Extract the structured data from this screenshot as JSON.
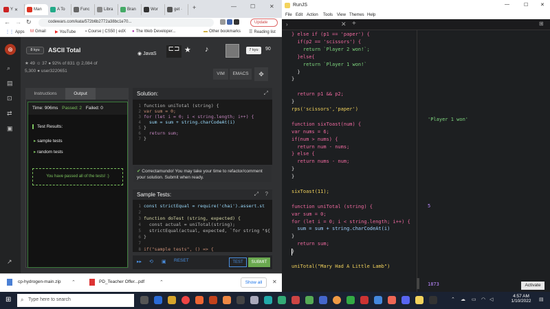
{
  "browser": {
    "tabs": [
      "Y",
      "Man",
      "A To",
      "Func",
      "Libra",
      "Bran",
      "Wor",
      "get ·"
    ],
    "url": "codewars.com/kata/572b6b2772a38bc1e70...",
    "update_label": "Update",
    "bookmarks": [
      "Apps",
      "Gmail",
      "YouTube",
      "Course | CS50 | edX",
      "The Web Developer...",
      "Other bookmarks",
      "Reading list"
    ]
  },
  "kata": {
    "rank": "8 kyu",
    "title": "ASCII Total",
    "stars": "49",
    "votes": "37",
    "satisfaction": "92% of 831",
    "completed": "2,084 of",
    "completed2": "5,300",
    "author": "user3220651",
    "language": "JavaS",
    "user_rank": "7 kyu",
    "honor": "90",
    "vim_label": "VIM",
    "emacs_label": "EMACS",
    "instructions_tab": "Instructions",
    "output_tab": "Output",
    "time": "Time: 906ms",
    "passed": "Passed: 2",
    "failed": "Failed: 0",
    "test_results": "Test Results:",
    "sample_tests_label": "sample tests",
    "random_tests_label": "random tests",
    "passed_msg": "You have passed all of the tests! :)",
    "solution_title": "Solution:",
    "toast": "Correctamundo! You may take your time to refactor/comment your solution. Submit when ready.",
    "sample_title": "Sample Tests:",
    "reset_label": "RESET",
    "test_label": "TEST",
    "submit_label": "SUBMIT",
    "solution_lines": [
      "function uniTotal (string) {",
      "var sum = 0;",
      "for (let i = 0; i < string.length; i++) {",
      "  sum = sum + string.charCodeAt(i)",
      "}",
      "  return sum;",
      "}"
    ],
    "sample_lines": [
      "const strictEqual = require('chai').assert.st",
      "",
      "function doTest (string, expected) {",
      "  const actual = uniTotal(string);",
      "  strictEqual(actual, expected, `for string \"${",
      "}",
      "",
      "if(\"sample tests\", () => {"
    ]
  },
  "downloads": {
    "file1": "cp-hydrogen-main.zip",
    "file2": "PD_Teacher Offer...pdf",
    "show_all": "Show all"
  },
  "runjs": {
    "title": "RunJS",
    "menu": [
      "File",
      "Edit",
      "Action",
      "Tools",
      "View",
      "Themes",
      "Help"
    ],
    "code_lines": [
      "} else if (p1 == 'paper') {",
      "  if(p2 == 'scissors') {",
      "    return `Player 2 won!`;",
      "  }else{",
      "    return `Player 1 won!`",
      "  }",
      "}",
      "",
      "  return p1 && p2;",
      "}",
      "rps('scissors','paper')",
      "",
      "function sixToast(num) {",
      "var nums = 6;",
      "if(num > nums) {",
      "  return num - nums;",
      "} else {",
      "  return nums - num;",
      "}",
      "}",
      "",
      "sixToast(11);",
      "",
      "function uniTotal (string) {",
      "var sum = 0;",
      "for (let i = 0; i < string.length; i++) {",
      "  sum = sum + string.charCodeAt(i)",
      "}",
      "  return sum;",
      "}",
      "",
      "uniTotal(\"Mary Had A Little Lamb\")"
    ],
    "output1": "'Player 1 won'",
    "output2": "5",
    "output3": "1873",
    "activate": "Activate"
  },
  "taskbar": {
    "search_placeholder": "Type here to search",
    "time": "4:57 AM",
    "date": "1/10/2022"
  }
}
